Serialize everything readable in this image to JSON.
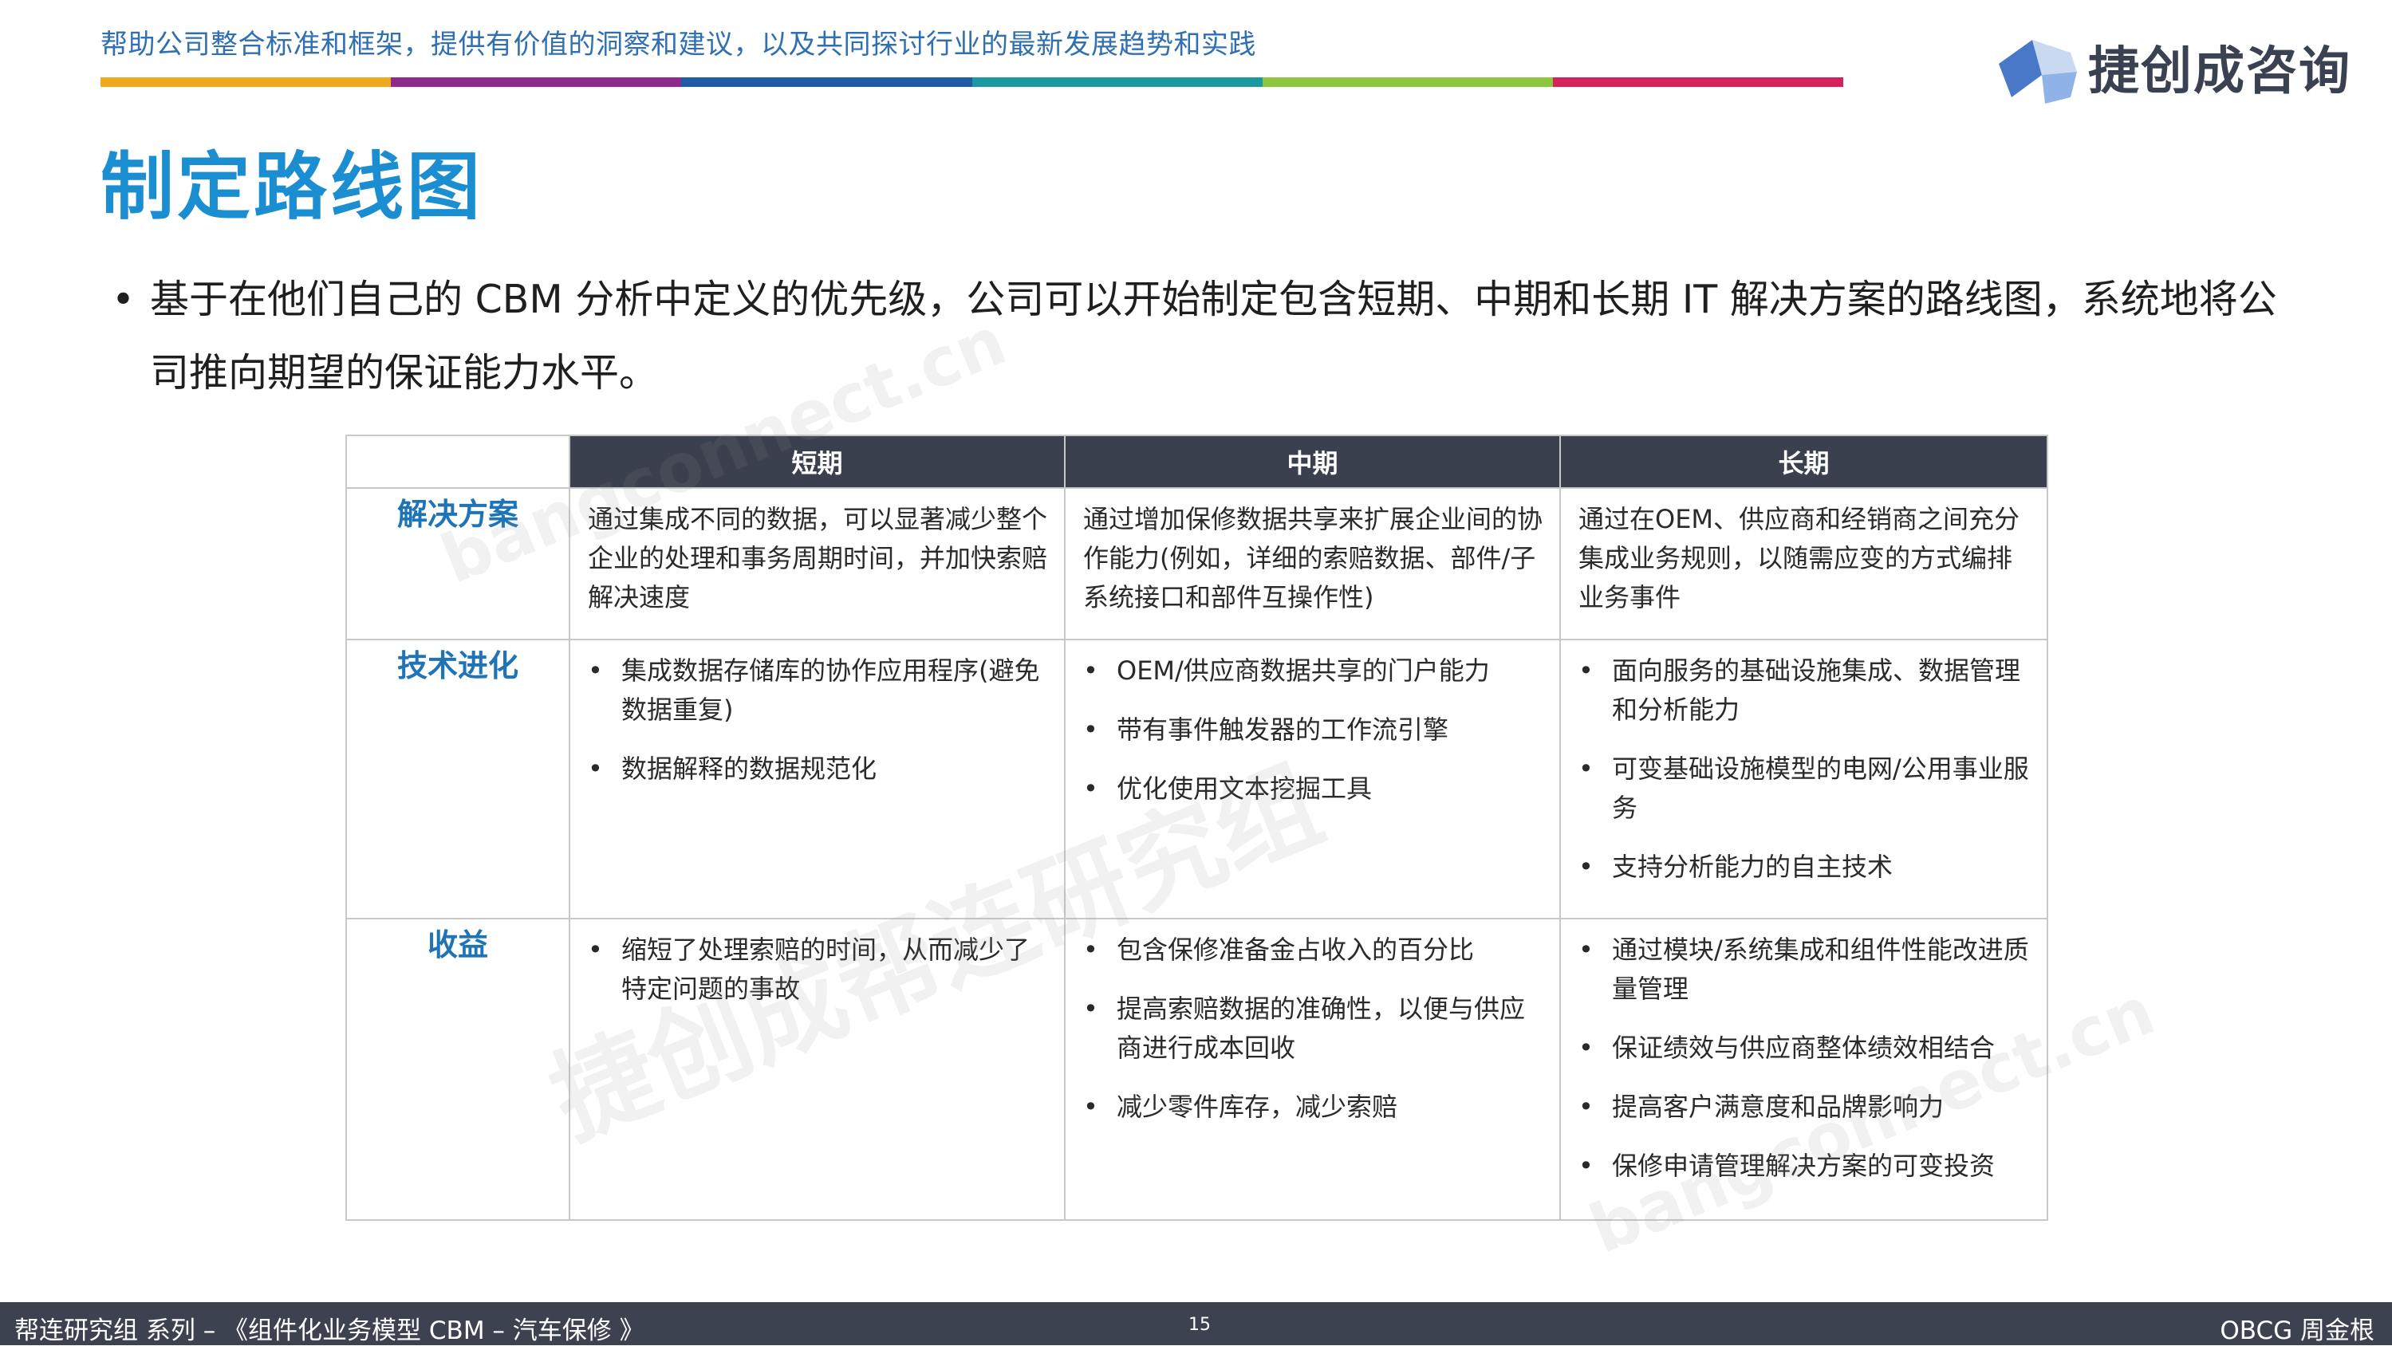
{
  "header": {
    "tagline": "帮助公司整合标准和框架，提供有价值的洞察和建议，以及共同探讨行业的最新发展趋势和实践",
    "band_colors": [
      "#f0a81e",
      "#8e2a8a",
      "#1f5aa6",
      "#1a9aa0",
      "#8dc63f",
      "#d6215c"
    ],
    "logo_text": "捷创成咨询",
    "logo_colors": [
      "#4a78c9",
      "#8fb3e8",
      "#c9d9f2"
    ]
  },
  "page_title": "制定路线图",
  "intro": {
    "bullet": "•",
    "text": "基于在他们自己的 CBM 分析中定义的优先级，公司可以开始制定包含短期、中期和长期 IT 解决方案的路线图，系统地将公司推向期望的保证能力水平。"
  },
  "table": {
    "columns": [
      "短期",
      "中期",
      "长期"
    ],
    "rows": [
      {
        "label": "解决方案",
        "cells": [
          {
            "text": "通过集成不同的数据，可以显著减少整个企业的处理和事务周期时间，并加快索赔解决速度"
          },
          {
            "text": "通过增加保修数据共享来扩展企业间的协作能力(例如，详细的索赔数据、部件/子系统接口和部件互操作性)"
          },
          {
            "text": "通过在OEM、供应商和经销商之间充分集成业务规则，以随需应变的方式编排业务事件"
          }
        ]
      },
      {
        "label": "技术进化",
        "cells": [
          {
            "items": [
              "集成数据存储库的协作应用程序(避免数据重复)",
              "数据解释的数据规范化"
            ]
          },
          {
            "items": [
              "OEM/供应商数据共享的门户能力",
              "带有事件触发器的工作流引擎",
              "优化使用文本挖掘工具"
            ]
          },
          {
            "items": [
              "面向服务的基础设施集成、数据管理和分析能力",
              "可变基础设施模型的电网/公用事业服务",
              "支持分析能力的自主技术"
            ]
          }
        ]
      },
      {
        "label": "收益",
        "cells": [
          {
            "items": [
              "缩短了处理索赔的时间，从而减少了特定问题的事故"
            ]
          },
          {
            "items": [
              "包含保修准备金占收入的百分比",
              "提高索赔数据的准确性，以便与供应商进行成本回收",
              "减少零件库存，减少索赔"
            ]
          },
          {
            "items": [
              "通过模块/系统集成和组件性能改进质量管理",
              "保证绩效与供应商整体绩效相结合",
              "提高客户满意度和品牌影响力",
              "保修申请管理解决方案的可变投资"
            ]
          }
        ]
      }
    ]
  },
  "watermarks": [
    "bangconnect.cn",
    "捷创成帮连研究组",
    "bangconnect.cn"
  ],
  "footer": {
    "left": "帮连研究组 系列 – 《组件化业务模型 CBM – 汽车保修 》",
    "page_number": "15",
    "right": "OBCG 周金根"
  }
}
